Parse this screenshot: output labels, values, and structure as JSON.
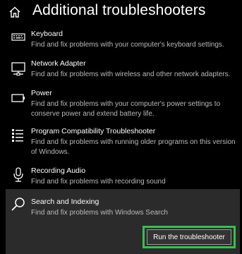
{
  "header": {
    "title": "Additional troubleshooters",
    "home_icon": "home-icon"
  },
  "items": [
    {
      "icon": "keyboard-icon",
      "title": "Keyboard",
      "description": "Find and fix problems with your computer's keyboard settings."
    },
    {
      "icon": "network-adapter-icon",
      "title": "Network Adapter",
      "description": "Find and fix problems with wireless and other network adapters."
    },
    {
      "icon": "power-icon",
      "title": "Power",
      "description": "Find and fix problems with your computer's power settings to conserve power and extend battery life."
    },
    {
      "icon": "program-compatibility-icon",
      "title": "Program Compatibility Troubleshooter",
      "description": "Find and fix problems with running older programs on this version of Windows."
    },
    {
      "icon": "microphone-icon",
      "title": "Recording Audio",
      "description": "Find and fix problems with recording sound"
    },
    {
      "icon": "search-icon",
      "title": "Search and Indexing",
      "description": "Find and fix problems with Windows Search"
    }
  ],
  "actions": {
    "run_label": "Run the troubleshooter"
  },
  "colors": {
    "background": "#000000",
    "selected_panel": "#2b2b2b",
    "highlight_outline": "#33c24d"
  }
}
